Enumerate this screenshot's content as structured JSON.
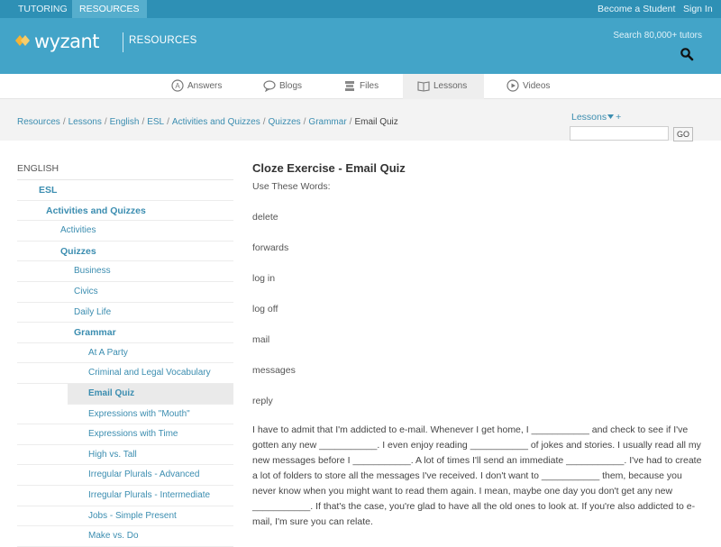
{
  "topbar": {
    "tabs": [
      "TUTORING",
      "RESOURCES"
    ],
    "become_student": "Become a Student",
    "sign_in": "Sign In"
  },
  "header": {
    "logo_text": "wyzant",
    "logo_sub": "RESOURCES",
    "search_note": "Search 80,000+ tutors",
    "brand_color": "#43a4c8"
  },
  "nav": {
    "items": [
      "Answers",
      "Blogs",
      "Files",
      "Lessons",
      "Videos"
    ],
    "active": "Lessons"
  },
  "breadcrumb": {
    "items": [
      "Resources",
      "Lessons",
      "English",
      "ESL",
      "Activities and Quizzes",
      "Quizzes",
      "Grammar"
    ],
    "current": "Email Quiz"
  },
  "search": {
    "dropdown_label": "Lessons",
    "plus": "+",
    "go_label": "GO"
  },
  "sidebar": {
    "heading": "ENGLISH",
    "items": [
      {
        "label": "ESL"
      },
      {
        "label": "Activities and Quizzes"
      },
      {
        "label": "Activities"
      },
      {
        "label": "Quizzes"
      },
      {
        "label": "Business"
      },
      {
        "label": "Civics"
      },
      {
        "label": "Daily Life"
      },
      {
        "label": "Grammar"
      },
      {
        "label": "At A Party"
      },
      {
        "label": "Criminal and Legal Vocabulary"
      },
      {
        "label": "Email Quiz"
      },
      {
        "label": "Expressions with \"Mouth\""
      },
      {
        "label": "Expressions with Time"
      },
      {
        "label": "High vs. Tall"
      },
      {
        "label": "Irregular Plurals - Advanced"
      },
      {
        "label": "Irregular Plurals - Intermediate"
      },
      {
        "label": "Jobs - Simple Present"
      },
      {
        "label": "Make vs. Do"
      }
    ]
  },
  "main": {
    "title": "Cloze Exercise - Email Quiz",
    "use_words": "Use These Words:",
    "words": [
      "delete",
      "forwards",
      "log in",
      "log off",
      "mail",
      "messages",
      "reply"
    ],
    "paragraph": "I have to admit that I'm addicted to e-mail. Whenever I get home, I ___________ and check to see if I've gotten any new ___________. I even enjoy reading ___________ of jokes and stories. I usually read all my new messages before I ___________. A lot of times I'll send an immediate ___________. I've had to create a lot of folders to store all the messages I've received. I don't want to ___________ them, because you never know when you might want to read them again. I mean, maybe one day you don't get any new ___________. If that's the case, you're glad to have all the old ones to look at. If you're also addicted to e-mail, I'm sure you can relate."
  }
}
